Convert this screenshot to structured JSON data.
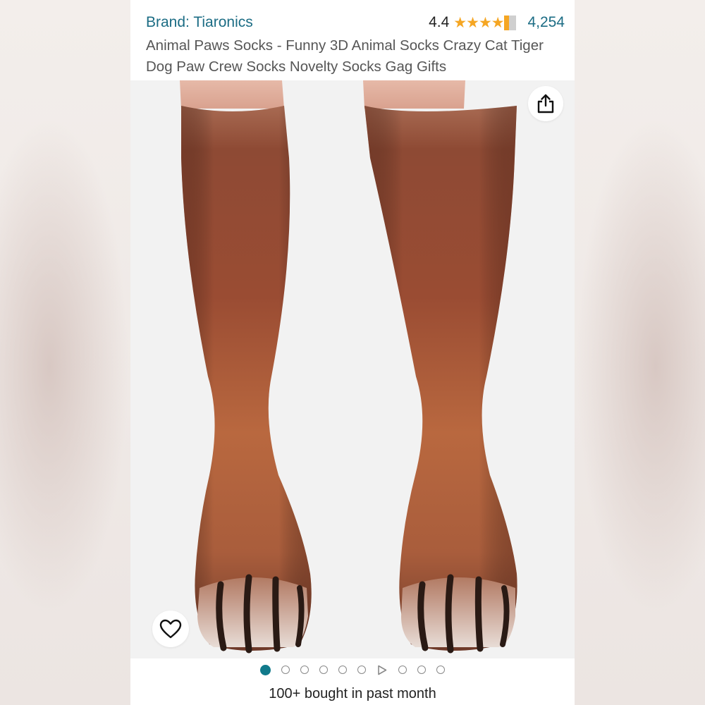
{
  "product": {
    "brand_link": "Brand: Tiaronics",
    "rating_value": "4.4",
    "rating": 4.4,
    "rating_max": 5,
    "review_count": "4,254",
    "title": "Animal Paws Socks - Funny 3D Animal Socks Crazy Cat Tiger Dog Paw Crew Socks Novelty Socks Gag Gifts",
    "bought_text": "100+ bought in past month"
  },
  "gallery": {
    "image_count": 10,
    "active_index": 0,
    "video_index": 6
  },
  "icons": {
    "share": "share-icon",
    "wishlist": "heart-icon",
    "video": "play-icon",
    "star": "star-icon"
  },
  "colors": {
    "link": "#1b6c84",
    "star": "#f5a623",
    "active_dot": "#117a8b",
    "text": "#222222",
    "title_text": "#565656"
  }
}
